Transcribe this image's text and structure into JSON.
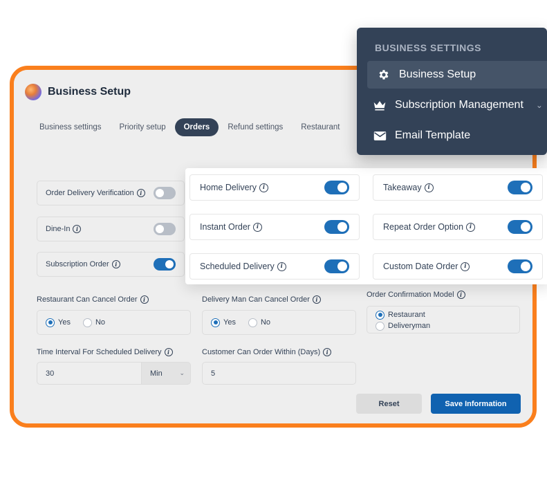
{
  "page": {
    "title": "Business Setup"
  },
  "tabs": [
    "Business settings",
    "Priority setup",
    "Orders",
    "Refund settings",
    "Restaurant"
  ],
  "active_tab_index": 2,
  "left_toggles": [
    {
      "label": "Order Delivery Verification",
      "on": false
    },
    {
      "label": "Dine-In",
      "on": false
    },
    {
      "label": "Subscription Order",
      "on": true
    }
  ],
  "panel_toggles": [
    {
      "label": "Home Delivery",
      "on": true
    },
    {
      "label": "Takeaway",
      "on": true
    },
    {
      "label": "Instant Order",
      "on": true
    },
    {
      "label": "Repeat Order Option",
      "on": true
    },
    {
      "label": "Scheduled Delivery",
      "on": true
    },
    {
      "label": "Custom Date Order",
      "on": true
    }
  ],
  "restaurant_cancel": {
    "label": "Restaurant Can Cancel Order",
    "options": [
      "Yes",
      "No"
    ],
    "selected": "Yes"
  },
  "deliveryman_cancel": {
    "label": "Delivery Man Can Cancel Order",
    "options": [
      "Yes",
      "No"
    ],
    "selected": "Yes"
  },
  "confirmation_model": {
    "label": "Order Confirmation Model",
    "options": [
      "Restaurant",
      "Deliveryman"
    ],
    "selected": "Restaurant"
  },
  "time_interval": {
    "label": "Time Interval For Scheduled Delivery",
    "value": "30",
    "unit": "Min"
  },
  "order_within": {
    "label": "Customer Can Order Within (Days)",
    "value": "5"
  },
  "buttons": {
    "reset": "Reset",
    "save": "Save Information"
  },
  "menu": {
    "heading": "BUSINESS SETTINGS",
    "items": [
      {
        "label": "Business Setup",
        "icon": "gear-icon",
        "active": true
      },
      {
        "label": "Subscription Management",
        "icon": "crown-icon",
        "has_chevron": true
      },
      {
        "label": "Email Template",
        "icon": "envelope-icon"
      }
    ]
  },
  "colors": {
    "frame": "#fa7f1d",
    "toggle_on": "#1e6fb8",
    "menu_bg": "#334257",
    "primary_button": "#1062b0"
  }
}
